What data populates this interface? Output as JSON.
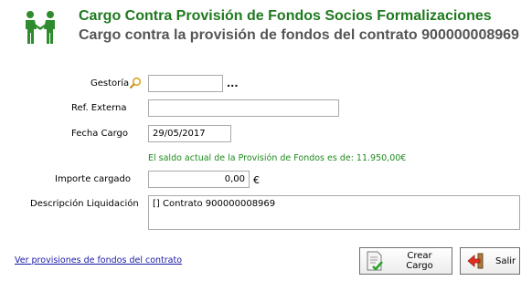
{
  "header": {
    "title": "Cargo Contra Provisión de Fondos Socios Formalizaciones",
    "subtitle": "Cargo contra la provisión de fondos del contrato 900000008969",
    "icon": "handshake-icon"
  },
  "form": {
    "gestoria": {
      "label": "Gestoría",
      "value": "",
      "icon": "search-icon",
      "more": "..."
    },
    "ref_externa": {
      "label": "Ref. Externa",
      "value": ""
    },
    "fecha_cargo": {
      "label": "Fecha Cargo",
      "value": "29/05/2017"
    },
    "saldo_message": "El saldo actual de la Provisión de Fondos es de: 11.950,00€",
    "importe": {
      "label": "Importe cargado",
      "value": "0,00",
      "currency": "€"
    },
    "descripcion": {
      "label": "Descripción Liquidación",
      "value": "[] Contrato 900000008969"
    }
  },
  "footer": {
    "link": "Ver provisiones de fondos del contrato",
    "crear_cargo": "Crear Cargo",
    "salir": "Salir"
  },
  "colors": {
    "title": "#1f7a1f",
    "subtitle": "#555555",
    "saldo": "#1e8b1e",
    "link": "#1a1aa6"
  }
}
